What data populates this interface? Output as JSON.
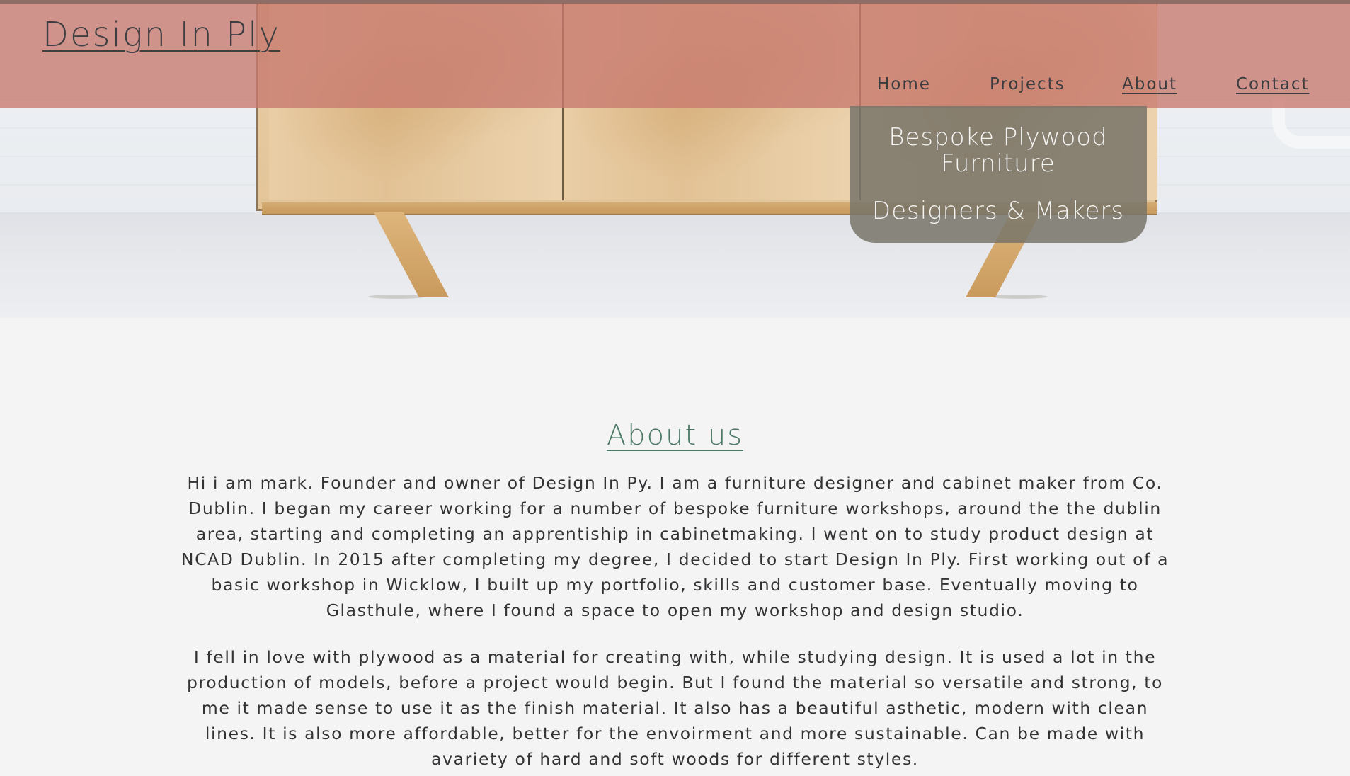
{
  "site": {
    "logo": "Design In Ply"
  },
  "nav": {
    "items": [
      {
        "label": "Home"
      },
      {
        "label": "Projects"
      },
      {
        "label": "About"
      },
      {
        "label": "Contact"
      }
    ]
  },
  "hero": {
    "tagline_line1": "Bespoke Plywood Furniture",
    "tagline_line2": "Designers & Makers"
  },
  "about": {
    "title": "About us",
    "paragraph1": "Hi i am mark. Founder and owner of Design In Py. I am a furniture designer and cabinet maker from Co. Dublin. I began my career working for a number of bespoke furniture workshops, around the the dublin area, starting and completing an apprentiship in cabinetmaking. I went on to study product design at NCAD Dublin. In 2015 after completing my degree, I decided to start Design In Ply. First working out of a basic workshop in Wicklow, I built up my portfolio, skills and customer base. Eventually moving to Glasthule, where I found a space to open my workshop and design studio.",
    "paragraph2": "I fell in love with plywood as a material for creating with, while studying design. It is used a lot in the production of models, before a project would begin. But I found the material so versatile and strong, to me it made sense to use it as the finish material. It also has a beautiful asthetic, modern with clean lines. It is also more affordable, better for the envoirment and more sustainable. Can be made with avariety of hard and soft woods for different styles."
  },
  "colors": {
    "header_band": "#c8786e",
    "accent_green": "#4d7a66",
    "tagline_card": "#78746a",
    "page_background": "#f4f4f4"
  }
}
